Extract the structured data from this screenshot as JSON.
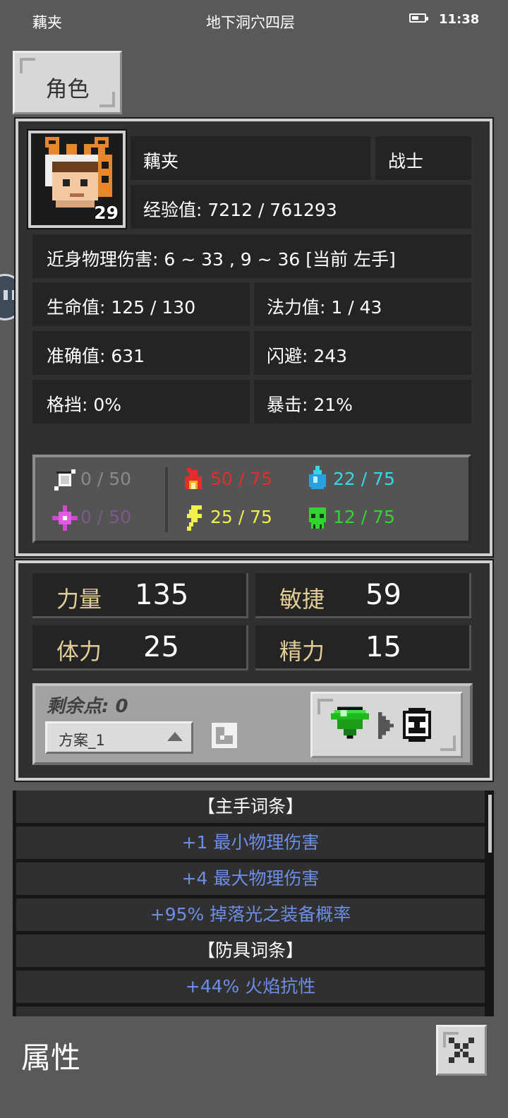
{
  "status_bar": {
    "left": "藕夹",
    "center": "地下洞穴四层",
    "time": "11:38"
  },
  "tab": {
    "label": "角色"
  },
  "character": {
    "name": "藕夹",
    "class": "战士",
    "level": "29",
    "experience": "经验值: 7212 / 761293",
    "melee_damage": "近身物理伤害: 6 ~ 33 , 9 ~ 36 [当前 左手]",
    "hp": "生命值: 125 / 130",
    "mp": "法力值: 1 / 43",
    "accuracy": "准确值: 631",
    "dodge": "闪避: 243",
    "block": "格挡: 0%",
    "crit": "暴击: 21%"
  },
  "resistances": {
    "physical": {
      "value": "0 / 50",
      "icon": "shield-blade-icon",
      "color": "#8a8a8a"
    },
    "arcane": {
      "value": "0 / 50",
      "icon": "magic-star-icon",
      "color": "#7a5a8a"
    },
    "fire": {
      "value": "50 / 75",
      "icon": "fire-icon",
      "color": "#e52c2c"
    },
    "lightning": {
      "value": "25 / 75",
      "icon": "lightning-icon",
      "color": "#f1f14b"
    },
    "ice": {
      "value": "22 / 75",
      "icon": "water-drop-icon",
      "color": "#34d7e8"
    },
    "poison": {
      "value": "12 / 75",
      "icon": "skull-icon",
      "color": "#32d432"
    }
  },
  "attributes": {
    "strength": {
      "label": "力量",
      "value": "135"
    },
    "agility": {
      "label": "敏捷",
      "value": "59"
    },
    "stamina": {
      "label": "体力",
      "value": "25"
    },
    "energy": {
      "label": "精力",
      "value": "15"
    }
  },
  "allocation": {
    "remaining": "剩余点: 0",
    "preset": "方案_1"
  },
  "affixes": [
    {
      "text": "【主手词条】",
      "kind": "header"
    },
    {
      "text": "+1 最小物理伤害",
      "kind": "affix"
    },
    {
      "text": "+4 最大物理伤害",
      "kind": "affix"
    },
    {
      "text": "+95% 掉落光之装备概率",
      "kind": "affix"
    },
    {
      "text": "【防具词条】",
      "kind": "header"
    },
    {
      "text": "+44% 火焰抗性",
      "kind": "affix"
    }
  ],
  "footer": {
    "title": "属性"
  }
}
